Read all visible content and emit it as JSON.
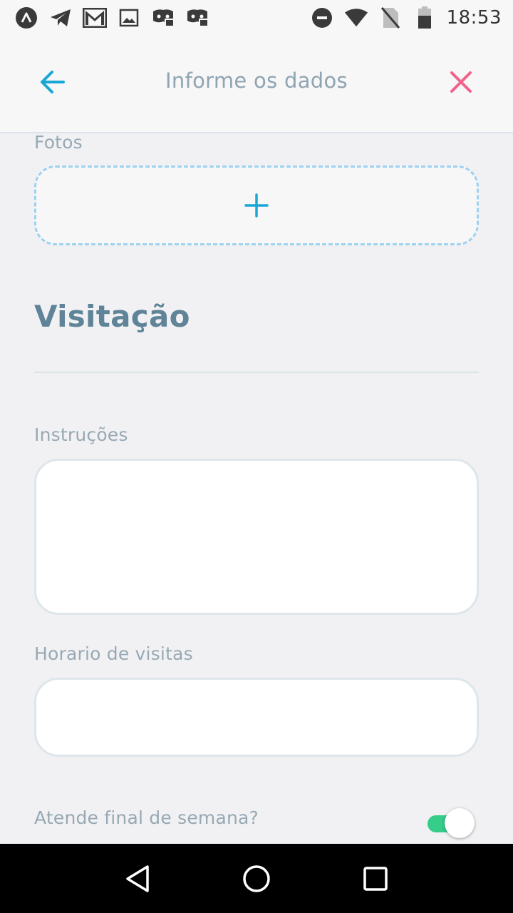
{
  "status_bar": {
    "time": "18:53",
    "left_icons": [
      "app-logo-icon",
      "telegram-icon",
      "gmail-icon",
      "image-icon",
      "discord-icon",
      "discord-icon"
    ],
    "right_icons": [
      "do-not-disturb-icon",
      "wifi-icon",
      "no-sim-icon",
      "battery-icon"
    ]
  },
  "header": {
    "title": "Informe os dados",
    "back_icon": "arrow-left-icon",
    "close_icon": "close-icon",
    "accent_color": "#1aa7d6",
    "close_color": "#f2628a"
  },
  "photos": {
    "label": "Fotos",
    "add_icon": "plus-icon"
  },
  "visitation": {
    "title": "Visitação",
    "instructions_label": "Instruções",
    "instructions_value": "",
    "visit_hours_label": "Horario de visitas",
    "visit_hours_value": "",
    "weekend_label": "Atende final de semana?",
    "weekend_toggle_on": true,
    "toggle_color": "#36cc8a"
  },
  "nav_bar": {
    "icons": [
      "back-triangle-icon",
      "home-circle-icon",
      "recents-square-icon"
    ]
  }
}
